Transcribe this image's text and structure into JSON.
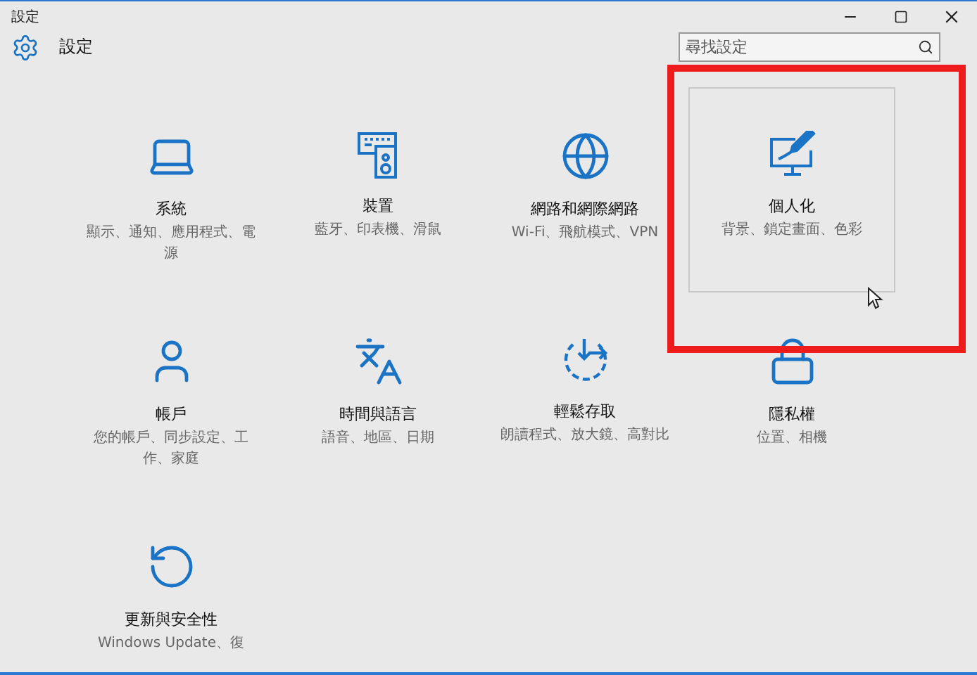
{
  "window": {
    "title": "設定"
  },
  "header": {
    "title": "設定"
  },
  "search": {
    "placeholder": "尋找設定"
  },
  "tiles": [
    {
      "kind": "system",
      "title": "系統",
      "description": "顯示、通知、應用程式、電源",
      "selected": false
    },
    {
      "kind": "devices",
      "title": "裝置",
      "description": "藍牙、印表機、滑鼠",
      "selected": false
    },
    {
      "kind": "network",
      "title": "網路和網際網路",
      "description": "Wi-Fi、飛航模式、VPN",
      "selected": false
    },
    {
      "kind": "personalization",
      "title": "個人化",
      "description": "背景、鎖定畫面、色彩",
      "selected": true
    },
    {
      "kind": "accounts",
      "title": "帳戶",
      "description": "您的帳戶、同步設定、工作、家庭",
      "selected": false
    },
    {
      "kind": "time",
      "title": "時間與語言",
      "description": "語音、地區、日期",
      "selected": false
    },
    {
      "kind": "access",
      "title": "輕鬆存取",
      "description": "朗讀程式、放大鏡、高對比",
      "selected": false
    },
    {
      "kind": "privacy",
      "title": "隱私權",
      "description": "位置、相機",
      "selected": false
    },
    {
      "kind": "update",
      "title": "更新與安全性",
      "description": "Windows Update、復",
      "selected": false
    }
  ]
}
